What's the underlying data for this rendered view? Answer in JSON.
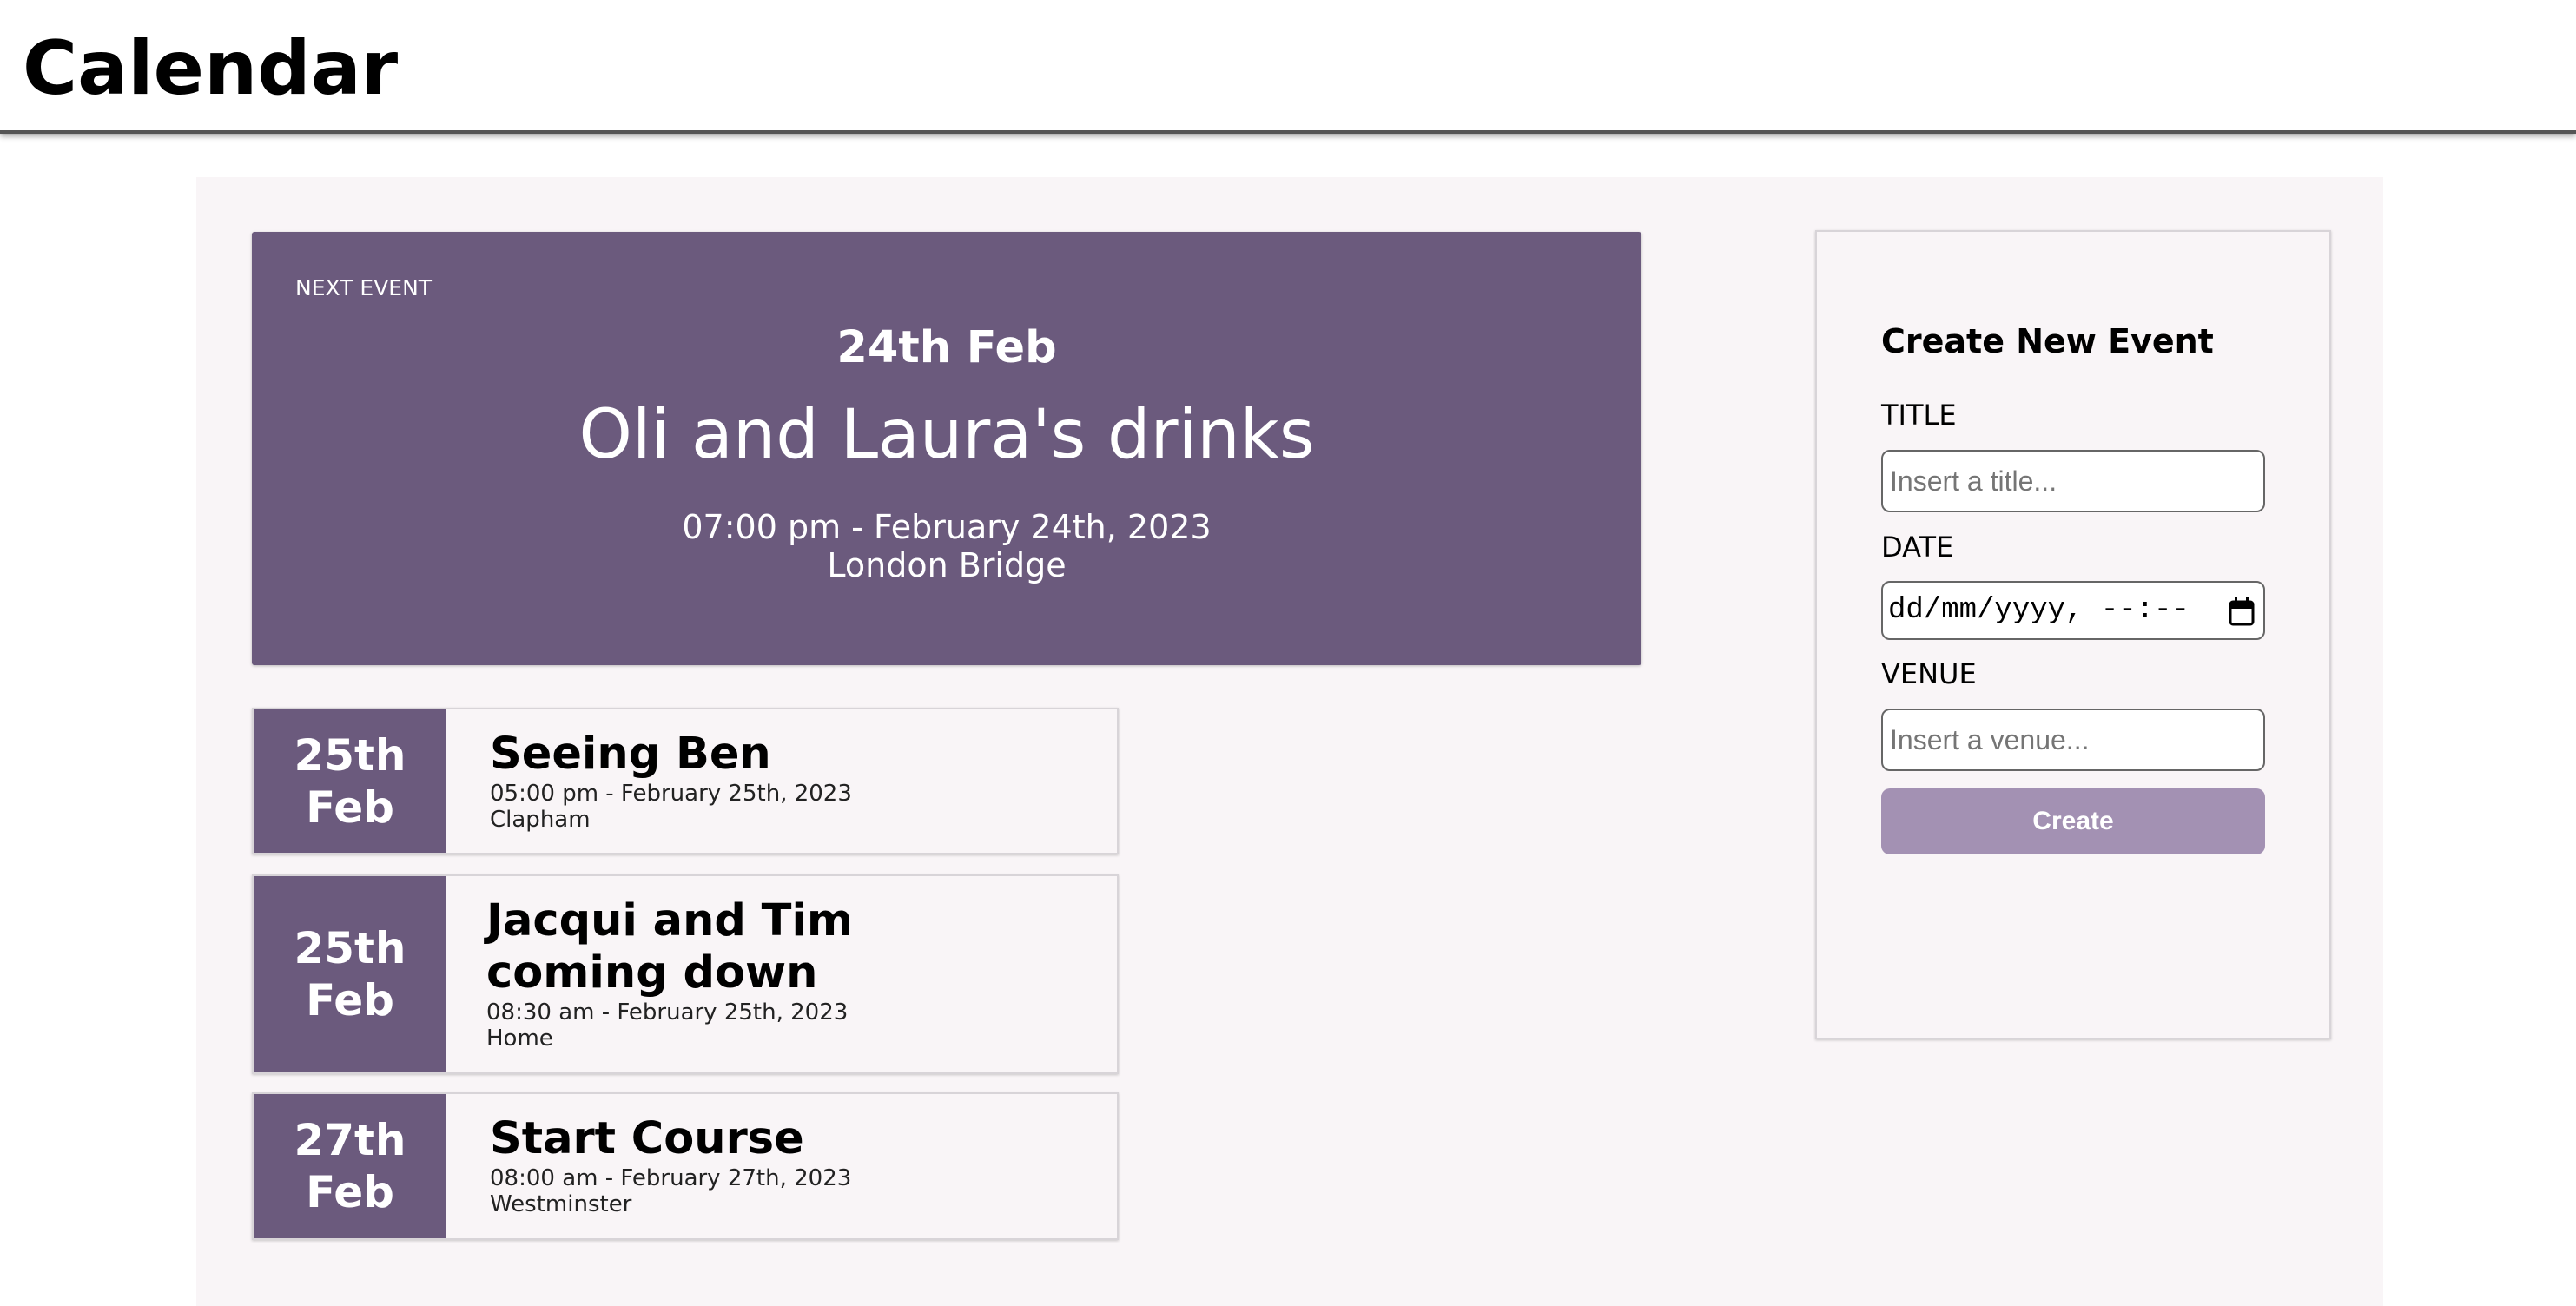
{
  "header": {
    "title": "Calendar"
  },
  "next_event": {
    "label": "NEXT EVENT",
    "date": "24th Feb",
    "title": "Oli and Laura's drinks",
    "time": "07:00 pm - February 24th, 2023",
    "venue": "London Bridge"
  },
  "events": [
    {
      "day": "25th",
      "month": "Feb",
      "title": "Seeing Ben",
      "time": "05:00 pm - February 25th, 2023",
      "venue": "Clapham"
    },
    {
      "day": "25th",
      "month": "Feb",
      "title": "Jacqui and Tim coming down",
      "time": "08:30 am - February 25th, 2023",
      "venue": "Home"
    },
    {
      "day": "27th",
      "month": "Feb",
      "title": "Start Course",
      "time": "08:00 am - February 27th, 2023",
      "venue": "Westminster"
    }
  ],
  "form": {
    "heading": "Create New Event",
    "title_label": "TITLE",
    "title_placeholder": "Insert a title...",
    "date_label": "DATE",
    "date_value": "dd/mm/yyyy, --:--",
    "venue_label": "VENUE",
    "venue_placeholder": "Insert a venue...",
    "create_label": "Create"
  },
  "colors": {
    "accent": "#6b5a7d",
    "button": "#a391b3",
    "panel_bg": "#f9f5f7"
  }
}
